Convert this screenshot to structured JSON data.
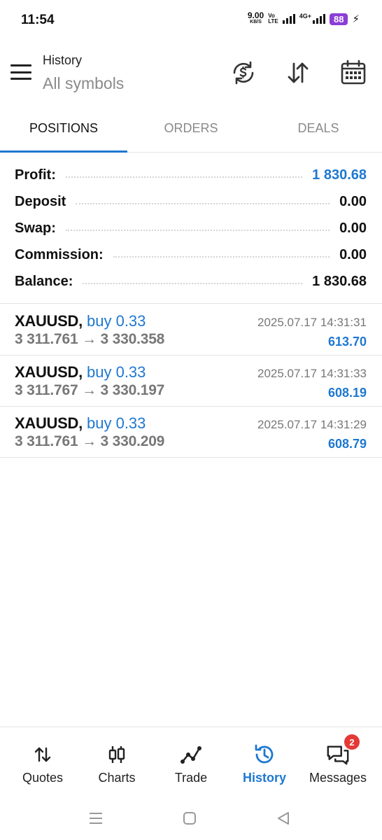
{
  "status_bar": {
    "time": "11:54",
    "net_speed_value": "9.00",
    "net_speed_unit": "KB/S",
    "volte_top": "Vo",
    "volte_bottom": "LTE",
    "network_type": "4G+",
    "battery": "88"
  },
  "header": {
    "title": "History",
    "subtitle": "All symbols",
    "icons": [
      "history-sync-icon",
      "sort-icon",
      "calendar-icon"
    ]
  },
  "tabs": [
    {
      "label": "POSITIONS",
      "active": true
    },
    {
      "label": "ORDERS",
      "active": false
    },
    {
      "label": "DEALS",
      "active": false
    }
  ],
  "summary": [
    {
      "label": "Profit:",
      "value": "1 830.68",
      "highlight": true
    },
    {
      "label": "Deposit",
      "value": "0.00",
      "highlight": false
    },
    {
      "label": "Swap:",
      "value": "0.00",
      "highlight": false
    },
    {
      "label": "Commission:",
      "value": "0.00",
      "highlight": false
    },
    {
      "label": "Balance:",
      "value": "1 830.68",
      "highlight": false
    }
  ],
  "deals": [
    {
      "symbol": "XAUUSD,",
      "type": "buy 0.33",
      "prices": "3 311.761 → 3 330.358",
      "time": "2025.07.17 14:31:31",
      "profit": "613.70"
    },
    {
      "symbol": "XAUUSD,",
      "type": "buy 0.33",
      "prices": "3 311.767 → 3 330.197",
      "time": "2025.07.17 14:31:33",
      "profit": "608.19"
    },
    {
      "symbol": "XAUUSD,",
      "type": "buy 0.33",
      "prices": "3 311.761 → 3 330.209",
      "time": "2025.07.17 14:31:29",
      "profit": "608.79"
    }
  ],
  "bottom_nav": [
    {
      "label": "Quotes",
      "icon": "quotes-icon",
      "active": false
    },
    {
      "label": "Charts",
      "icon": "charts-icon",
      "active": false
    },
    {
      "label": "Trade",
      "icon": "trade-icon",
      "active": false
    },
    {
      "label": "History",
      "icon": "history-icon",
      "active": true
    },
    {
      "label": "Messages",
      "icon": "messages-icon",
      "active": false,
      "badge": "2"
    }
  ],
  "colors": {
    "accent": "#1e78d0",
    "battery": "#8b3fd6",
    "badge": "#e53935",
    "muted": "#8a8a8a"
  }
}
